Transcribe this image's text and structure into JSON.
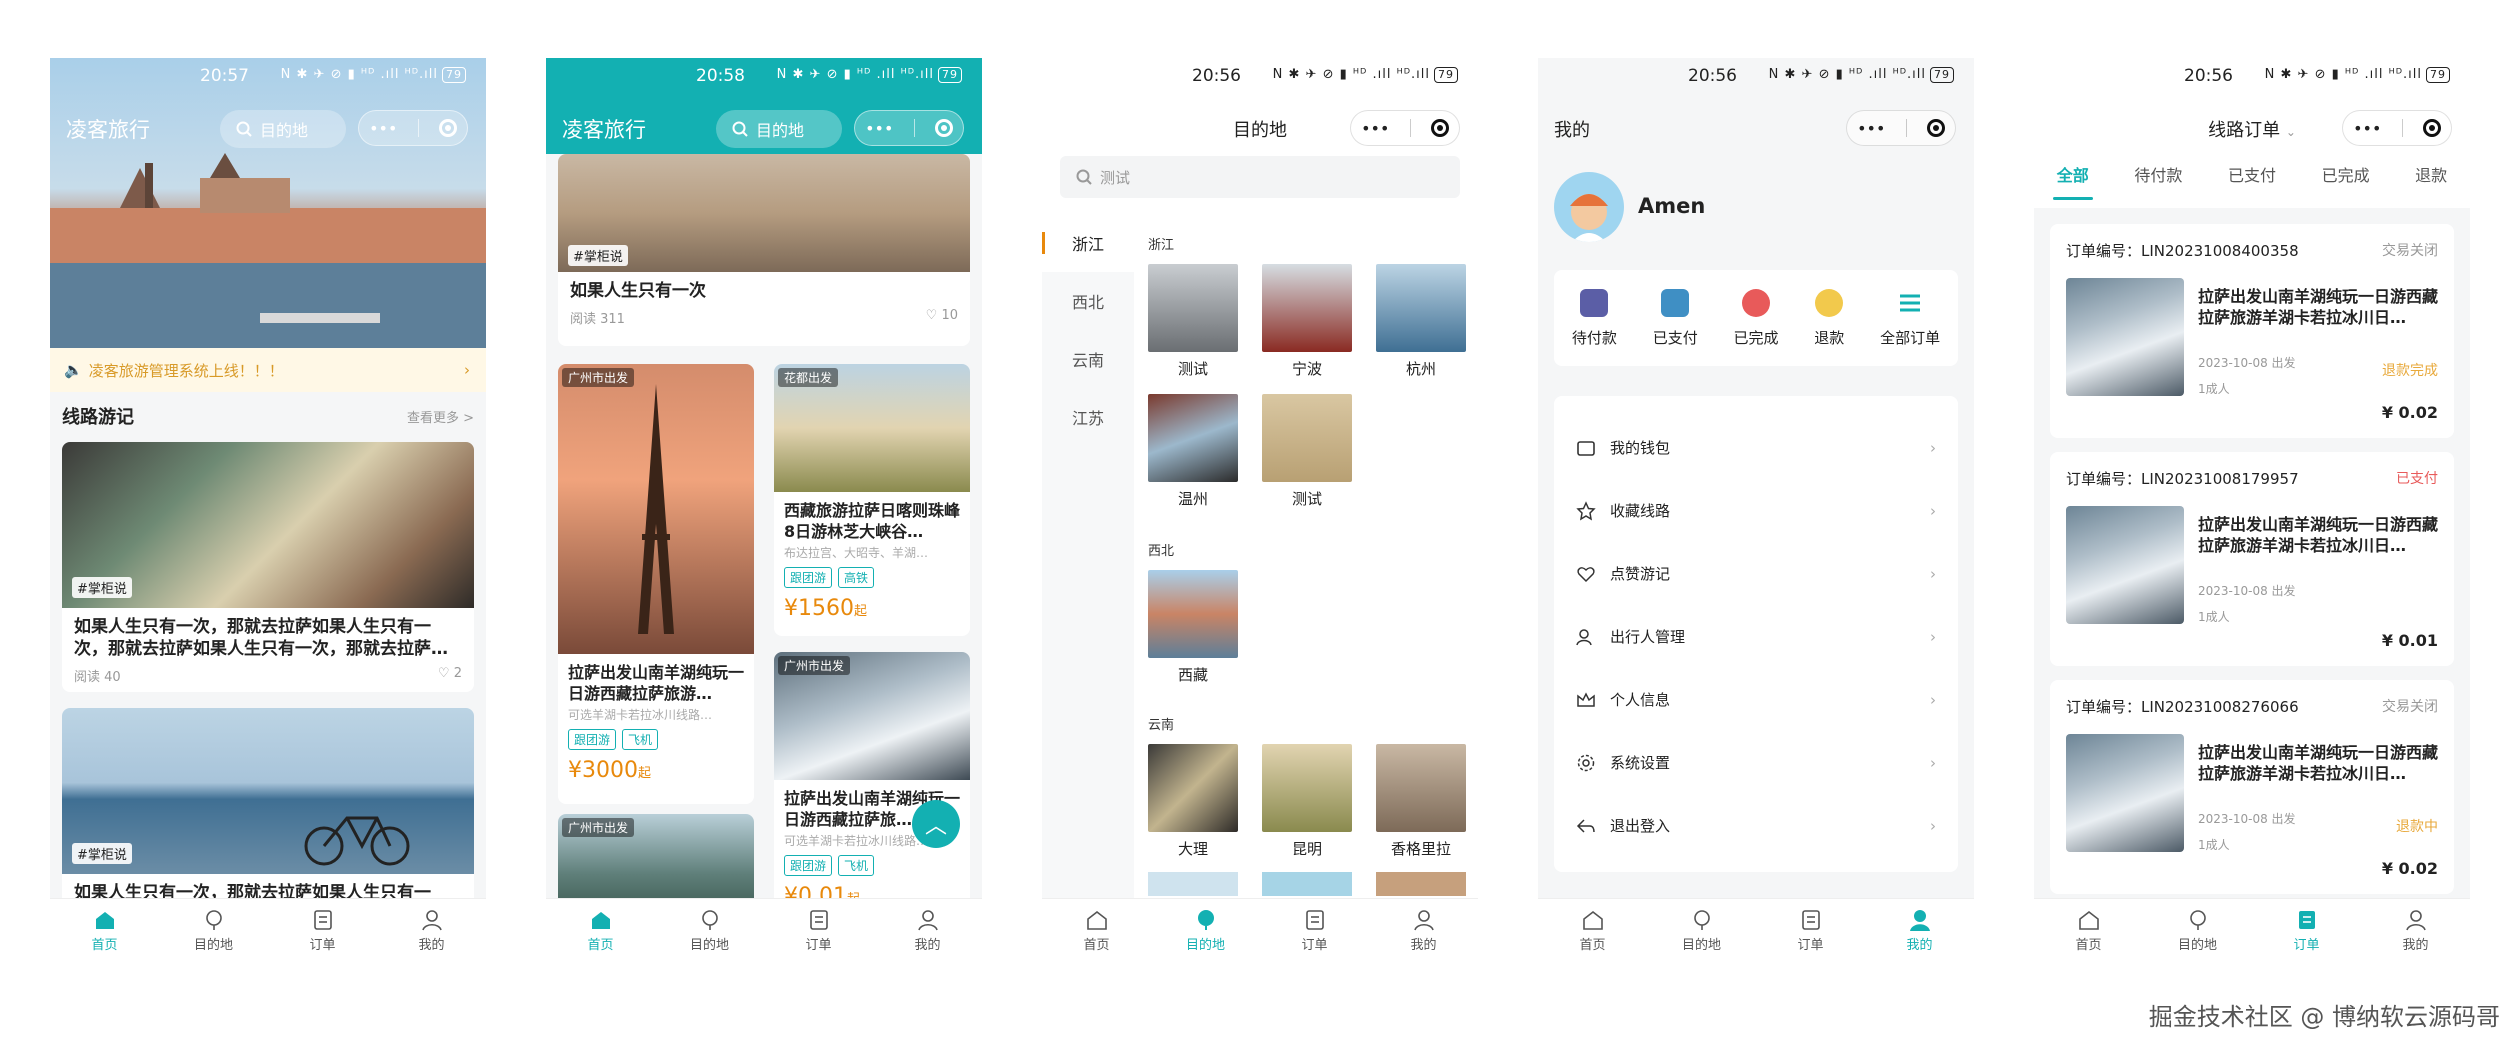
{
  "status": {
    "battery": "79",
    "icons": "N ✱ ✈ ⊘ ▮ ᴴᴰ .ıll ᴴᴰ.ıll"
  },
  "tabbar": [
    {
      "label": "首页",
      "icon": "home-icon"
    },
    {
      "label": "目的地",
      "icon": "location-icon"
    },
    {
      "label": "订单",
      "icon": "order-icon"
    },
    {
      "label": "我的",
      "icon": "user-icon"
    }
  ],
  "screen1": {
    "time": "20:57",
    "title": "凌客旅行",
    "search": "目的地",
    "notice": "凌客旅游管理系统上线！！！",
    "section_title": "线路游记",
    "section_more": "查看更多 >",
    "cards": [
      {
        "tag": "#掌柜说",
        "title": "如果人生只有一次，那就去拉萨如果人生只有一次，那就去拉萨如果人生只有一次，那就去拉萨…",
        "reads": "阅读 40",
        "likes": "2"
      },
      {
        "tag": "#掌柜说",
        "title": "如果人生只有一次，那就去拉萨如果人生只有一"
      }
    ]
  },
  "screen2": {
    "time": "20:58",
    "title": "凌客旅行",
    "search": "目的地",
    "top_card": {
      "tag": "#掌柜说",
      "title": "如果人生只有一次",
      "reads": "阅读 311",
      "likes": "10"
    },
    "wf": [
      {
        "label": "广州市出发",
        "title": "拉萨出发山南羊湖纯玩一日游西藏拉萨旅游…",
        "sub": "可选羊湖卡若拉冰川线路…",
        "chips": [
          "跟团游",
          "飞机"
        ],
        "price": "¥3000",
        "unit": "起"
      },
      {
        "label": "花都出发",
        "title": "西藏旅游拉萨日喀则珠峰8日游林芝大峡谷…",
        "sub": "布达拉宫、大昭寺、羊湖…",
        "chips": [
          "跟团游",
          "高铁"
        ],
        "price": "¥1560",
        "unit": "起"
      },
      {
        "label": "广州市出发",
        "title": "拉萨出发山南羊湖纯玩一日游西藏拉萨旅…",
        "sub": "可选羊湖卡若拉冰川线路…",
        "chips": [
          "跟团游",
          "飞机"
        ],
        "price": "¥0.01",
        "unit": "起"
      },
      {
        "label": "广州市出发"
      }
    ]
  },
  "screen3": {
    "time": "20:56",
    "title": "目的地",
    "search": "测试",
    "sidebar": [
      "浙江",
      "西北",
      "云南",
      "江苏"
    ],
    "regions": [
      {
        "name": "浙江",
        "items": [
          "测试",
          "宁波",
          "杭州",
          "温州",
          "测试"
        ]
      },
      {
        "name": "西北",
        "items": [
          "西藏"
        ]
      },
      {
        "name": "云南",
        "items": [
          "大理",
          "昆明",
          "香格里拉"
        ]
      }
    ]
  },
  "screen4": {
    "time": "20:56",
    "title": "我的",
    "username": "Amen",
    "quick": [
      "待付款",
      "已支付",
      "已完成",
      "退款",
      "全部订单"
    ],
    "menu": [
      "我的钱包",
      "收藏线路",
      "点赞游记",
      "出行人管理",
      "个人信息",
      "系统设置",
      "退出登入"
    ]
  },
  "screen5": {
    "time": "20:56",
    "title": "线路订单",
    "tabs": [
      "全部",
      "待付款",
      "已支付",
      "已完成",
      "退款"
    ],
    "orders": [
      {
        "no": "订单编号：LIN20231008400358",
        "status": "交易关闭",
        "title": "拉萨出发山南羊湖纯玩一日游西藏拉萨旅游羊湖卡若拉冰川日…",
        "date": "2023-10-08 出发",
        "people": "1成人",
        "refund": "退款完成",
        "amount": "¥ 0.02"
      },
      {
        "no": "订单编号：LIN20231008179957",
        "status": "已支付",
        "title": "拉萨出发山南羊湖纯玩一日游西藏拉萨旅游羊湖卡若拉冰川日…",
        "date": "2023-10-08 出发",
        "people": "1成人",
        "refund": "",
        "amount": "¥ 0.01"
      },
      {
        "no": "订单编号：LIN20231008276066",
        "status": "交易关闭",
        "title": "拉萨出发山南羊湖纯玩一日游西藏拉萨旅游羊湖卡若拉冰川日…",
        "date": "2023-10-08 出发",
        "people": "1成人",
        "refund": "退款中",
        "amount": "¥ 0.02"
      }
    ]
  },
  "watermark": "掘金技术社区 @ 博纳软云源码哥",
  "colors": {
    "accent": "#13b0b2",
    "price": "#e8890c",
    "notice_bg": "#fff8e6"
  }
}
